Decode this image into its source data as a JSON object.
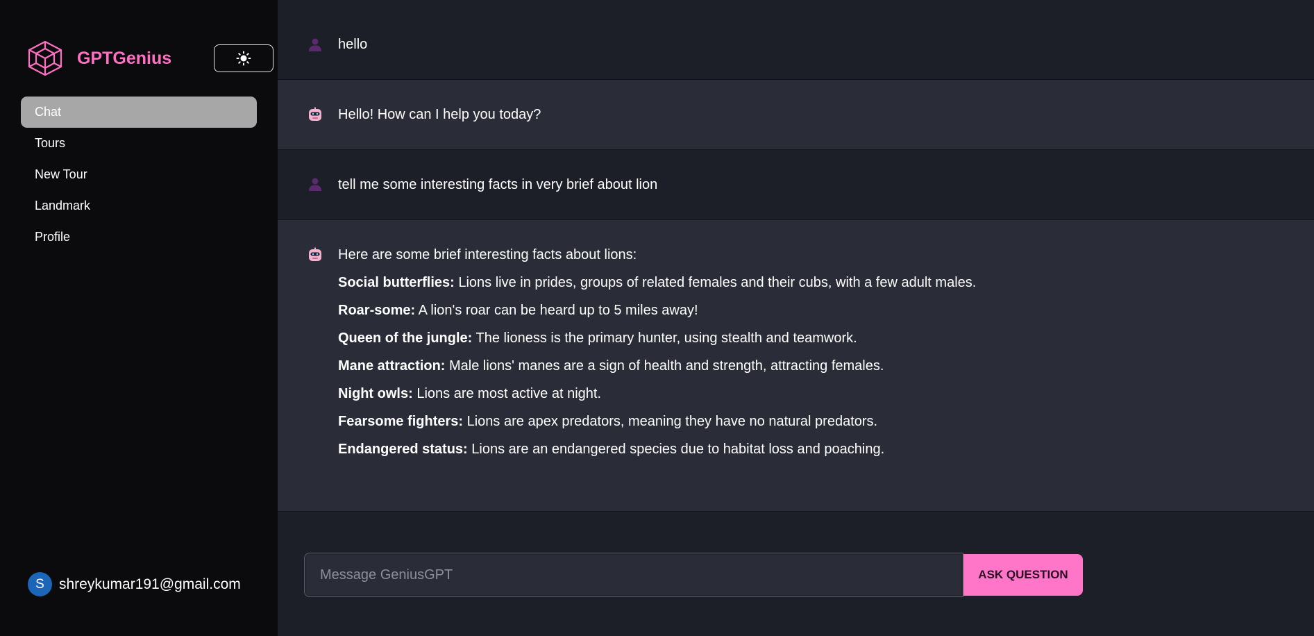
{
  "app": {
    "brand_name": "GPTGenius",
    "brand_color": "#ff6fc2",
    "logo_icon": "hexagon-cube-logo",
    "theme_toggle_icon": "sun-icon"
  },
  "sidebar": {
    "items": [
      {
        "label": "Chat",
        "active": true
      },
      {
        "label": "Tours",
        "active": false
      },
      {
        "label": "New Tour",
        "active": false
      },
      {
        "label": "Landmark",
        "active": false
      },
      {
        "label": "Profile",
        "active": false
      }
    ],
    "user": {
      "initial": "S",
      "email": "shreykumar191@gmail.com"
    }
  },
  "chat": {
    "messages": [
      {
        "role": "user",
        "icon": "user-avatar-icon",
        "text": "hello"
      },
      {
        "role": "assistant",
        "icon": "robot-icon",
        "text": "Hello! How can I help you today?"
      },
      {
        "role": "user",
        "icon": "user-avatar-icon",
        "text": "tell me some interesting facts in very brief about lion"
      },
      {
        "role": "assistant",
        "icon": "robot-icon",
        "intro": "Here are some brief interesting facts about lions:",
        "facts": [
          {
            "title": "Social butterflies:",
            "text": " Lions live in prides, groups of related females and their cubs, with a few adult males."
          },
          {
            "title": "Roar-some:",
            "text": " A lion's roar can be heard up to 5 miles away!"
          },
          {
            "title": "Queen of the jungle:",
            "text": " The lioness is the primary hunter, using stealth and teamwork."
          },
          {
            "title": "Mane attraction:",
            "text": " Male lions' manes are a sign of health and strength, attracting females."
          },
          {
            "title": "Night owls:",
            "text": " Lions are most active at night."
          },
          {
            "title": "Fearsome fighters:",
            "text": " Lions are apex predators, meaning they have no natural predators."
          },
          {
            "title": "Endangered status:",
            "text": " Lions are an endangered species due to habitat loss and poaching."
          }
        ]
      }
    ]
  },
  "composer": {
    "placeholder": "Message GeniusGPT",
    "value": "",
    "button_label": "ASK QUESTION",
    "button_color": "#ff76c9"
  }
}
